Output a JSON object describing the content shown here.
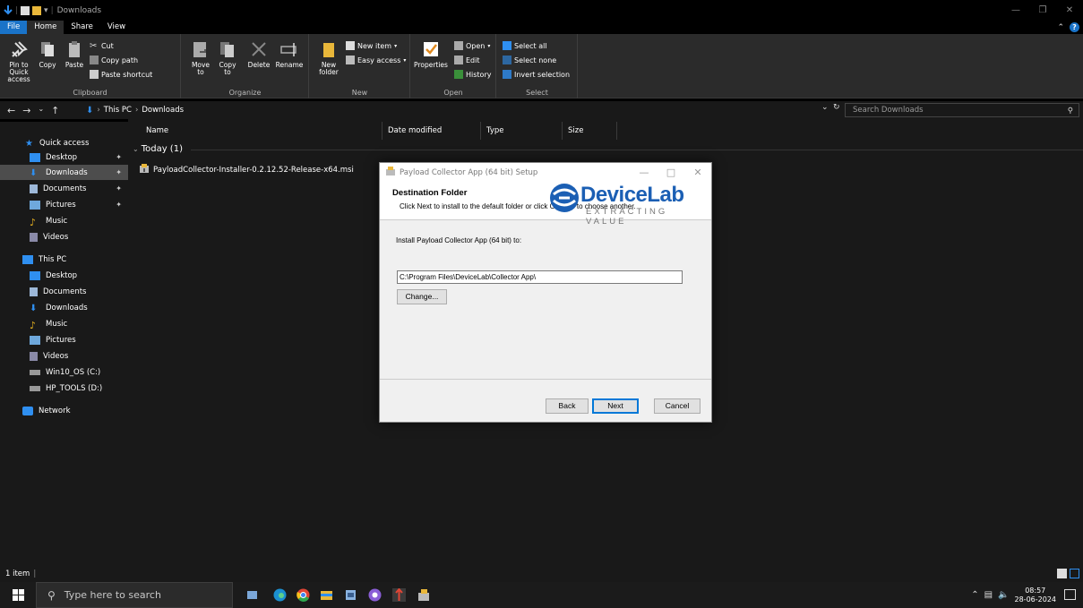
{
  "window": {
    "title": "Downloads"
  },
  "ribbon_tabs": [
    "File",
    "Home",
    "Share",
    "View"
  ],
  "ribbon": {
    "clipboard": {
      "label": "Clipboard",
      "pin_to_quick_access": "Pin to Quick access",
      "copy": "Copy",
      "paste": "Paste",
      "cut": "Cut",
      "copy_path": "Copy path",
      "paste_shortcut": "Paste shortcut"
    },
    "organize": {
      "label": "Organize",
      "move_to": "Move to",
      "copy_to": "Copy to",
      "delete": "Delete",
      "rename": "Rename"
    },
    "new": {
      "label": "New",
      "new_folder": "New folder",
      "new_item": "New item",
      "easy_access": "Easy access"
    },
    "open": {
      "label": "Open",
      "properties": "Properties",
      "open": "Open",
      "edit": "Edit",
      "history": "History"
    },
    "select": {
      "label": "Select",
      "select_all": "Select all",
      "select_none": "Select none",
      "invert_selection": "Invert selection"
    }
  },
  "address": {
    "crumbs": [
      "This PC",
      "Downloads"
    ],
    "search_placeholder": "Search Downloads"
  },
  "nav": {
    "quick_access": "Quick access",
    "quick_items": [
      "Desktop",
      "Downloads",
      "Documents",
      "Pictures",
      "Music",
      "Videos"
    ],
    "this_pc": "This PC",
    "pc_items": [
      "Desktop",
      "Documents",
      "Downloads",
      "Music",
      "Pictures",
      "Videos",
      "Win10_OS (C:)",
      "HP_TOOLS (D:)"
    ],
    "network": "Network"
  },
  "columns": {
    "name": "Name",
    "date_modified": "Date modified",
    "type": "Type",
    "size": "Size"
  },
  "group": {
    "label": "Today (1)"
  },
  "files": [
    {
      "name": "PayloadCollector-Installer-0.2.12.52-Release-x64.msi"
    }
  ],
  "status": {
    "count": "1 item"
  },
  "taskbar": {
    "search_placeholder": "Type here to search",
    "time": "08:57",
    "date": "28-06-2024"
  },
  "dialog": {
    "title": "Payload Collector App (64 bit) Setup",
    "header_title": "Destination Folder",
    "header_sub": "Click Next to install to the default folder or click Change to choose another.",
    "logo_main": "DeviceLab",
    "logo_sub": "EXTRACTING VALUE",
    "install_label": "Install Payload Collector App (64 bit) to:",
    "path": "C:\\Program Files\\DeviceLab\\Collector App\\",
    "change": "Change...",
    "back": "Back",
    "next": "Next",
    "cancel": "Cancel"
  },
  "colors": {
    "accent": "#1a73c8",
    "logo_blue": "#1b5fb4"
  }
}
